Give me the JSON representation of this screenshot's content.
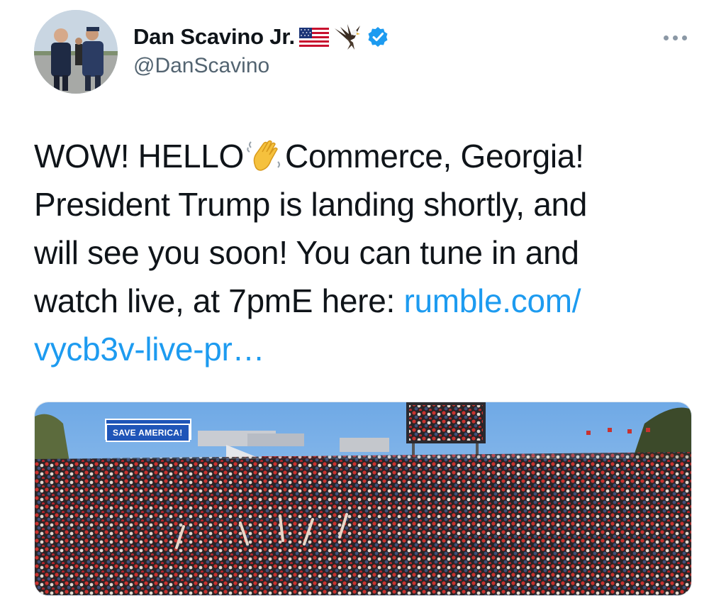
{
  "author": {
    "display_name": "Dan Scavino Jr.",
    "handle": "@DanScavino",
    "verified": true,
    "name_emojis": [
      "us-flag-emoji",
      "eagle-emoji"
    ]
  },
  "tweet": {
    "text_lines": [
      {
        "before": "WOW! HELLO",
        "emoji": "waving-hand-emoji",
        "after": "Commerce, Georgia!"
      },
      {
        "text": "President Trump is landing shortly, and"
      },
      {
        "text": "will see you soon! You can tune in and"
      },
      {
        "text": "watch live, at 7pmE here: ",
        "link": "rumble.com/"
      },
      {
        "link": "vycb3v-live-pr…"
      }
    ]
  },
  "media": {
    "banner_text": "SAVE AMERICA!",
    "description_icon": "rally-crowd-photo"
  },
  "colors": {
    "link": "#1d9bf0",
    "text": "#0f1419",
    "secondary": "#536471",
    "verified": "#1d9bf0"
  }
}
